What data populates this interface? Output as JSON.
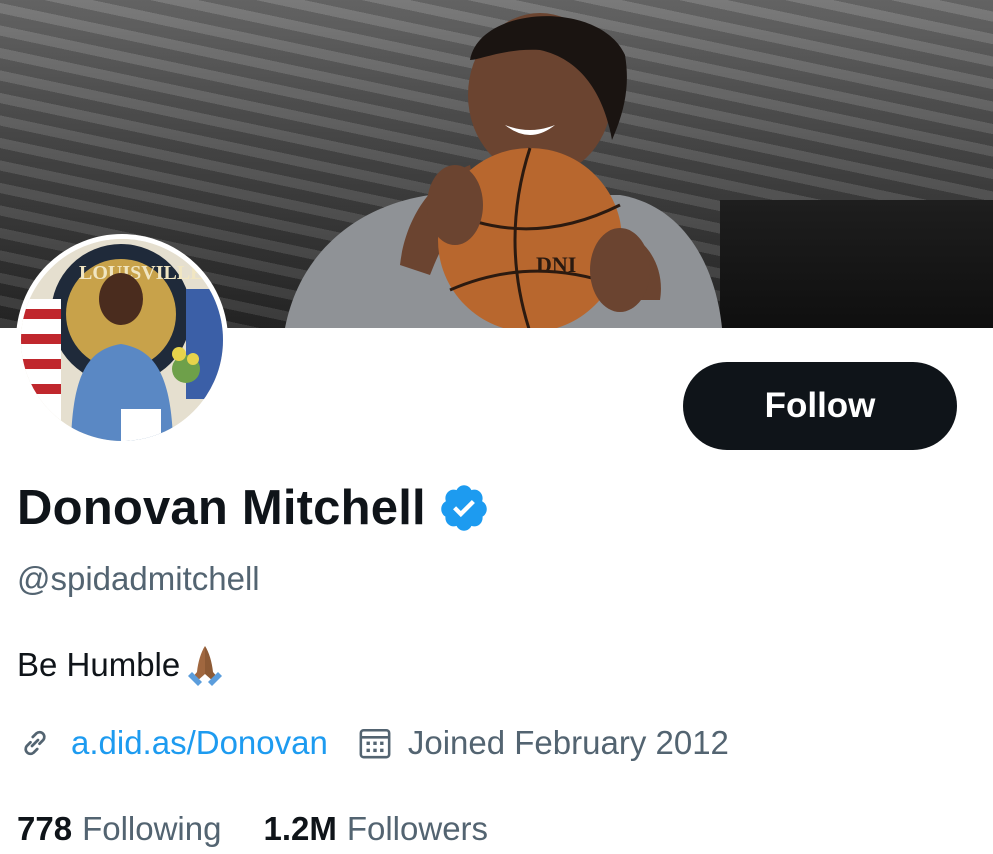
{
  "profile": {
    "display_name": "Donovan Mitchell",
    "handle": "@spidadmitchell",
    "bio": "Be Humble",
    "website": "a.did.as/Donovan",
    "joined": "Joined February 2012"
  },
  "stats": {
    "following_count": "778",
    "following_label": "Following",
    "followers_count": "1.2M",
    "followers_label": "Followers"
  },
  "actions": {
    "follow_label": "Follow"
  },
  "banner": {
    "ball_text": "DNI"
  },
  "avatar": {
    "seal_text": "LOUISVILLE"
  },
  "colors": {
    "accent": "#1d9bf0",
    "text": "#0f1419",
    "secondary": "#536471",
    "button": "#0f1419"
  },
  "icons": {
    "verified": "verified-badge-icon",
    "link": "link-icon",
    "calendar": "calendar-icon",
    "emoji": "folded-hands-icon"
  }
}
